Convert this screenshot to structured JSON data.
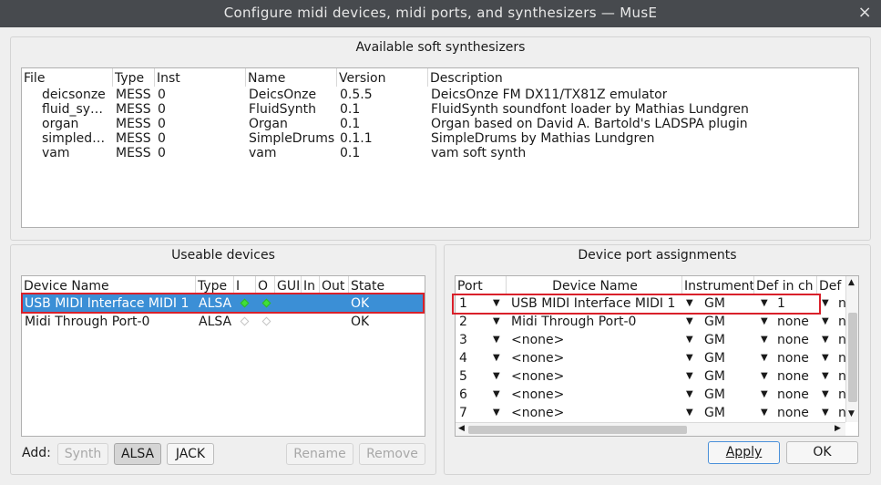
{
  "window": {
    "title": "Configure midi devices, midi ports, and synthesizers — MusE",
    "close_glyph": "×"
  },
  "synths": {
    "title": "Available soft synthesizers",
    "columns": [
      "File",
      "Type",
      "Inst",
      "Name",
      "Version",
      "Description"
    ],
    "rows": [
      {
        "file": "deicsonze",
        "type": "MESS",
        "inst": "0",
        "name": "DeicsOnze",
        "version": "0.5.5",
        "description": "DeicsOnze FM DX11/TX81Z emulator"
      },
      {
        "file": "fluid_sy…",
        "type": "MESS",
        "inst": "0",
        "name": "FluidSynth",
        "version": "0.1",
        "description": "FluidSynth soundfont loader by Mathias Lundgren"
      },
      {
        "file": "organ",
        "type": "MESS",
        "inst": "0",
        "name": "Organ",
        "version": "0.1",
        "description": "Organ based on David A. Bartold's LADSPA plugin"
      },
      {
        "file": "simpled…",
        "type": "MESS",
        "inst": "0",
        "name": "SimpleDrums",
        "version": "0.1.1",
        "description": "SimpleDrums by Mathias Lundgren"
      },
      {
        "file": "vam",
        "type": "MESS",
        "inst": "0",
        "name": "vam",
        "version": "0.1",
        "description": "vam soft synth"
      }
    ]
  },
  "devices": {
    "title": "Useable devices",
    "columns": [
      "Device Name",
      "Type",
      "I",
      "O",
      "GUI",
      "In",
      "Out",
      "State"
    ],
    "rows": [
      {
        "name": "USB MIDI Interface MIDI 1",
        "type": "ALSA",
        "i_on": true,
        "o_on": true,
        "state": "OK",
        "selected": true
      },
      {
        "name": "Midi Through Port-0",
        "type": "ALSA",
        "i_on": false,
        "o_on": false,
        "state": "OK",
        "selected": false
      }
    ],
    "add_label": "Add:",
    "buttons": {
      "synth": "Synth",
      "alsa": "ALSA",
      "jack": "JACK",
      "rename": "Rename",
      "remove": "Remove"
    }
  },
  "ports": {
    "title": "Device port assignments",
    "columns": [
      "Port",
      "Device Name",
      "Instrument",
      "Def in ch",
      "Def o"
    ],
    "rows": [
      {
        "port": "1",
        "device": "USB MIDI Interface MIDI 1",
        "instrument": "GM",
        "def_in": "1",
        "def_out": "n"
      },
      {
        "port": "2",
        "device": "Midi Through Port-0",
        "instrument": "GM",
        "def_in": "none",
        "def_out": "n"
      },
      {
        "port": "3",
        "device": "<none>",
        "instrument": "GM",
        "def_in": "none",
        "def_out": "n"
      },
      {
        "port": "4",
        "device": "<none>",
        "instrument": "GM",
        "def_in": "none",
        "def_out": "n"
      },
      {
        "port": "5",
        "device": "<none>",
        "instrument": "GM",
        "def_in": "none",
        "def_out": "n"
      },
      {
        "port": "6",
        "device": "<none>",
        "instrument": "GM",
        "def_in": "none",
        "def_out": "n"
      },
      {
        "port": "7",
        "device": "<none>",
        "instrument": "GM",
        "def_in": "none",
        "def_out": "n"
      }
    ],
    "dropdown_glyph": "▼"
  },
  "dialog_buttons": {
    "apply": "Apply",
    "ok": "OK"
  }
}
